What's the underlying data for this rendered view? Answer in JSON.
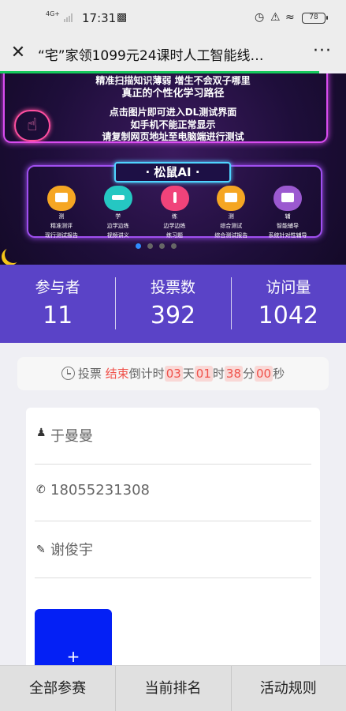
{
  "status_bar": {
    "network": "4G+",
    "time": "17:31",
    "battery": "78",
    "icons": [
      "nfc-icon",
      "alarm-icon",
      "mute-icon",
      "wifi-icon",
      "battery-icon"
    ]
  },
  "nav": {
    "close_icon": "close-icon",
    "title": "“宅”家领1099元24课时人工智能线…",
    "more_icon": "more-icon",
    "accent": "#17c95c"
  },
  "banner": {
    "line1": "精准扫描知识薄弱  增生不会双子哪里",
    "line2": "真正的个性化学习路径",
    "line3": "点击图片即可进入DL测试界面",
    "line4": "如手机不能正常显示",
    "line5": "请复制网页地址至电脑端进行测试",
    "ai_tag": "· 松鼠AI ·",
    "items": [
      {
        "char": "测",
        "label1": "精准测评",
        "label2": "现行测试报告",
        "color": "#f5a623"
      },
      {
        "char": "学",
        "label1": "边学边练",
        "label2": "视频讲义",
        "color": "#25c7c2"
      },
      {
        "char": "练",
        "label1": "边学边练",
        "label2": "练习题",
        "color": "#f0437a"
      },
      {
        "char": "测",
        "label1": "综合测试",
        "label2": "综合测试报告",
        "color": "#f5a623"
      },
      {
        "char": "辅",
        "label1": "智能辅导",
        "label2": "系统针对性辅导",
        "color": "#9b59d0"
      }
    ]
  },
  "stats": {
    "participants_label": "参与者",
    "participants": "11",
    "votes_label": "投票数",
    "votes": "392",
    "visits_label": "访问量",
    "visits": "1042",
    "bg_color": "#5a43c7"
  },
  "countdown": {
    "prefix": "投票",
    "status": "结束",
    "countdown_label": "倒计时",
    "days": "03",
    "day_unit": "天",
    "hours": "01",
    "hour_unit": "时",
    "minutes": "38",
    "minute_unit": "分",
    "seconds": "00",
    "second_unit": "秒"
  },
  "form": {
    "name": "于曼曼",
    "phone": "18055231308",
    "note": "谢俊宇",
    "upload_symbol": "+",
    "upload_color": "#0420f5"
  },
  "tabs": [
    {
      "label": "全部参赛"
    },
    {
      "label": "当前排名"
    },
    {
      "label": "活动规则"
    }
  ]
}
